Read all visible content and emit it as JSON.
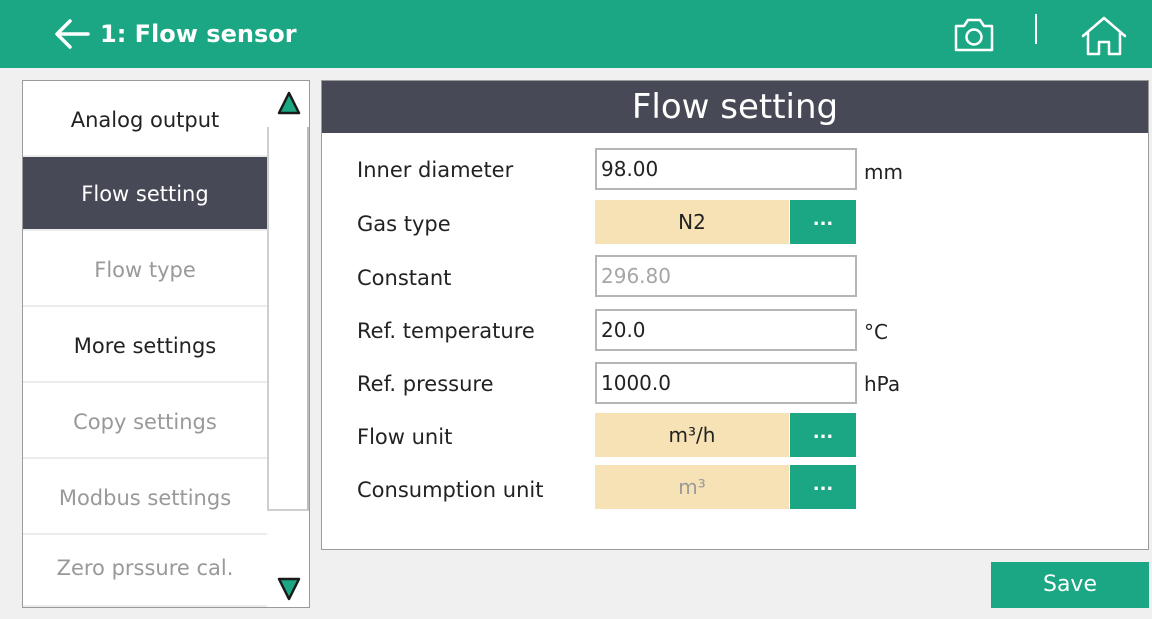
{
  "header": {
    "title": "1: Flow sensor",
    "back_icon": "arrow-left-icon",
    "camera_icon": "camera-icon",
    "home_icon": "home-icon",
    "accent_color": "#1ba783"
  },
  "menu": {
    "items": [
      {
        "label": "Analog output",
        "state": "enabled"
      },
      {
        "label": "Flow setting",
        "state": "active"
      },
      {
        "label": "Flow type",
        "state": "disabled"
      },
      {
        "label": "More settings",
        "state": "enabled"
      },
      {
        "label": "Copy settings",
        "state": "disabled"
      },
      {
        "label": "Modbus settings",
        "state": "disabled"
      },
      {
        "label": "Zero prssure cal.",
        "state": "disabled"
      }
    ],
    "scroll_up_icon": "triangle-up-icon",
    "scroll_down_icon": "triangle-down-icon"
  },
  "panel": {
    "title": "Flow setting",
    "inner_diameter": {
      "label": "Inner diameter",
      "value": "98.00",
      "unit": "mm"
    },
    "gas_type": {
      "label": "Gas type",
      "value": "N2",
      "button": "..."
    },
    "constant": {
      "label": "Constant",
      "value": "296.80"
    },
    "ref_temperature": {
      "label": "Ref. temperature",
      "value": "20.0",
      "unit": "°C"
    },
    "ref_pressure": {
      "label": "Ref. pressure",
      "value": "1000.0",
      "unit": "hPa"
    },
    "flow_unit": {
      "label": "Flow unit",
      "value": "m³/h",
      "button": "..."
    },
    "consumption_unit": {
      "label": "Consumption unit",
      "value": "m³",
      "button": "..."
    }
  },
  "save_label": "Save",
  "colors": {
    "accent": "#1ba783",
    "dark": "#474a56",
    "select_bg": "#f7e2b6"
  }
}
